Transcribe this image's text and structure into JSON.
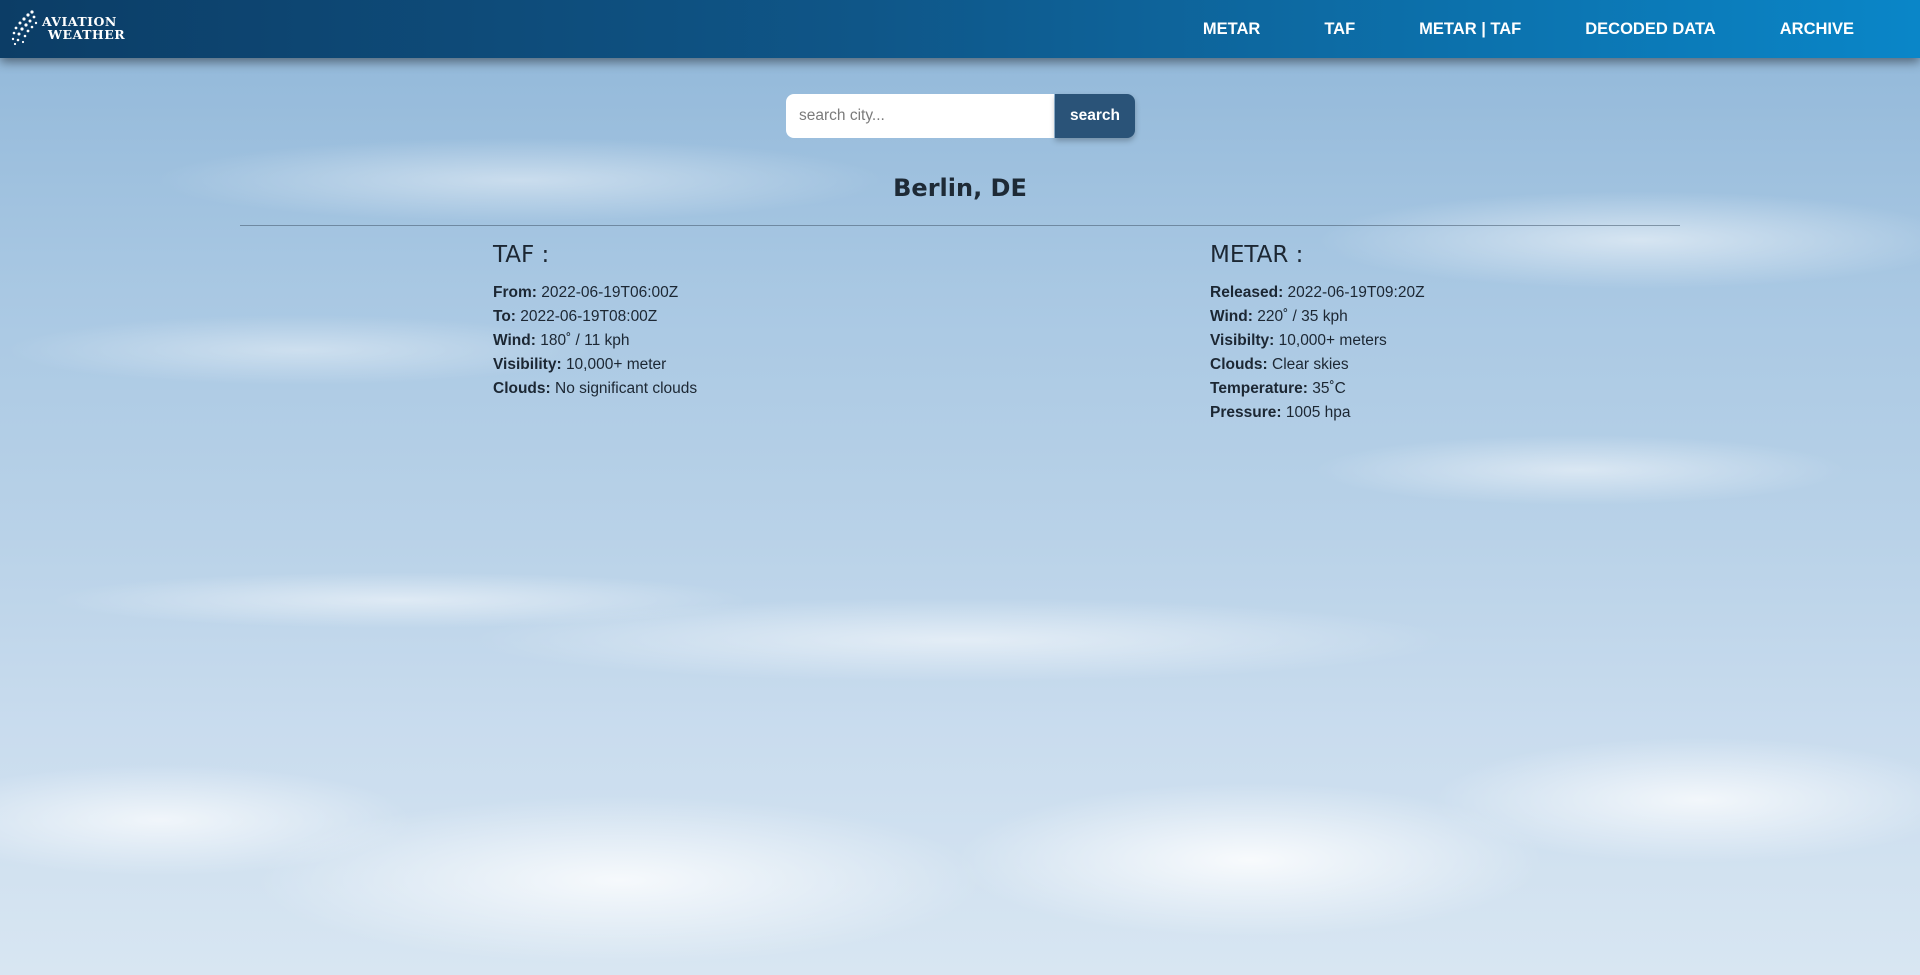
{
  "logo": {
    "line1": "AVIATION",
    "line2": "WEATHER"
  },
  "nav": [
    {
      "label": "METAR"
    },
    {
      "label": "TAF"
    },
    {
      "label": "METAR | TAF"
    },
    {
      "label": "DECODED DATA"
    },
    {
      "label": "ARCHIVE"
    }
  ],
  "search": {
    "placeholder": "search city...",
    "value": "",
    "button_label": "search"
  },
  "city": "Berlin, DE",
  "taf": {
    "title": "TAF :",
    "rows": [
      {
        "label": "From:",
        "value": "2022-06-19T06:00Z"
      },
      {
        "label": "To:",
        "value": "2022-06-19T08:00Z"
      },
      {
        "label": "Wind:",
        "value": "180˚ / 11 kph"
      },
      {
        "label": "Visibility:",
        "value": "10,000+ meter"
      },
      {
        "label": "Clouds:",
        "value": "No significant clouds"
      }
    ]
  },
  "metar": {
    "title": "METAR :",
    "rows": [
      {
        "label": "Released:",
        "value": "2022-06-19T09:20Z"
      },
      {
        "label": "Wind:",
        "value": "220˚ / 35 kph"
      },
      {
        "label": "Visibilty:",
        "value": "10,000+ meters"
      },
      {
        "label": "Clouds:",
        "value": "Clear skies"
      },
      {
        "label": "Temperature:",
        "value": "35˚C"
      },
      {
        "label": "Pressure:",
        "value": "1005 hpa"
      }
    ]
  },
  "colors": {
    "nav_start": "#0c3d66",
    "nav_end": "#0a86c8",
    "search_button": "#2a5378",
    "text": "#1c2733"
  }
}
